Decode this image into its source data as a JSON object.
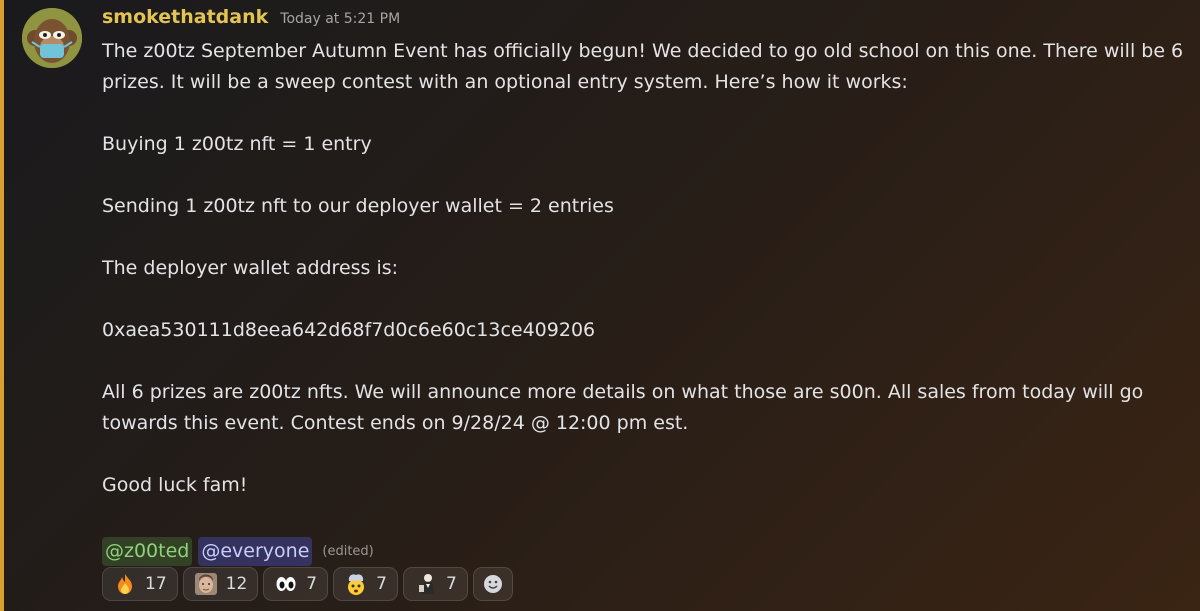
{
  "message": {
    "author": "smokethatdank",
    "timestamp": "Today at 5:21 PM",
    "lines": {
      "p1": "The z00tz September Autumn Event has officially begun! We decided to go old school on this one. There will be 6 prizes. It will be a sweep contest with an optional entry system. Here’s how it works:",
      "p2": "Buying 1 z00tz nft = 1 entry",
      "p3": "Sending 1 z00tz nft to our deployer wallet = 2 entries",
      "p4": "The deployer wallet address is:",
      "p5": "0xaea530111d8eea642d68f7d0c6e60c13ce409206",
      "p6": "All 6 prizes are z00tz nfts. We will announce more details on what those are s00n. All sales from today will go towards this event. Contest ends on 9/28/24 @ 12:00 pm est.",
      "p7": "Good luck fam!"
    },
    "mentions": {
      "role": "@z00ted",
      "everyone": "@everyone",
      "edited": "(edited)"
    }
  },
  "reactions": [
    {
      "emoji": "fire-emoji",
      "count": "17"
    },
    {
      "emoji": "custom-face-emoji",
      "count": "12"
    },
    {
      "emoji": "eyes-emoji",
      "count": "7"
    },
    {
      "emoji": "exploding-head-emoji",
      "count": "7"
    },
    {
      "emoji": "custom-figure-emoji",
      "count": "7"
    }
  ],
  "add_reaction": {
    "icon": "add-reaction-icon"
  },
  "colors": {
    "username": "#e3c452",
    "mention_bar": "#d9a030",
    "role_mention": "#8fd27a",
    "everyone_mention": "#c9ccff"
  }
}
